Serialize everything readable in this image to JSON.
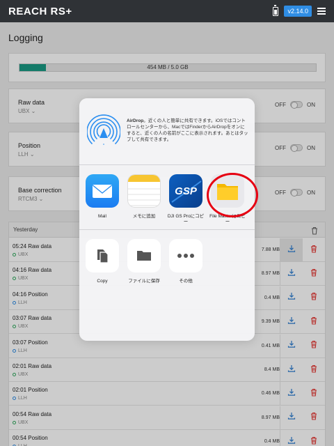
{
  "topbar": {
    "brand": "REACH RS+",
    "version": "v2.14.0"
  },
  "page": {
    "title": "Logging"
  },
  "storage": {
    "text": "454 MB / 5.0 GB",
    "used_fraction": 0.09
  },
  "streams": [
    {
      "label": "Raw data",
      "format": "UBX ⌄",
      "off": "OFF",
      "on": "ON"
    },
    {
      "label": "Position",
      "format": "LLH ⌄",
      "off": "OFF",
      "on": "ON"
    },
    {
      "label": "Base correction",
      "format": "RTCM3 ⌄",
      "off": "OFF",
      "on": "ON"
    }
  ],
  "log": {
    "header": "Yesterday",
    "rows": [
      {
        "time": "05:24 Raw data",
        "fmt": "UBX",
        "size": "7.88 MB",
        "dot": "green"
      },
      {
        "time": "04:16 Raw data",
        "fmt": "UBX",
        "size": "8.97 MB",
        "dot": "green"
      },
      {
        "time": "04:16 Position",
        "fmt": "LLH",
        "size": "0.4 MB",
        "dot": "blue"
      },
      {
        "time": "03:07 Raw data",
        "fmt": "UBX",
        "size": "9.39 MB",
        "dot": "green"
      },
      {
        "time": "03:07 Position",
        "fmt": "LLH",
        "size": "0.41 MB",
        "dot": "blue"
      },
      {
        "time": "02:01 Raw data",
        "fmt": "UBX",
        "size": "8.4 MB",
        "dot": "green"
      },
      {
        "time": "02:01 Position",
        "fmt": "LLH",
        "size": "0.46 MB",
        "dot": "blue"
      },
      {
        "time": "00:54 Raw data",
        "fmt": "UBX",
        "size": "8.97 MB",
        "dot": "green"
      },
      {
        "time": "00:54 Position",
        "fmt": "LLH",
        "size": "0.4 MB",
        "dot": "blue"
      }
    ]
  },
  "share_sheet": {
    "airdrop_title": "AirDrop",
    "airdrop_text": "。近くの人と簡単に共有できます。iOSではコントロールセンターから、MacではFinderからAirDropをオンにすると、近くの人の名前がここに表示されます。あとはタップして共有できます。",
    "apps": [
      {
        "label": "Mail"
      },
      {
        "label": "メモに追加"
      },
      {
        "label": "DJI GS Proにコピー",
        "icon_text": "GSP"
      },
      {
        "label": "File Masterにコピー"
      }
    ],
    "actions": [
      {
        "label": "Copy"
      },
      {
        "label": "ファイルに保存"
      },
      {
        "label": "その他"
      }
    ]
  },
  "colors": {
    "topbar": "#2f3236",
    "accent": "#1a9a84",
    "version_badge": "#2f8de4",
    "delete": "#e53935",
    "highlight": "#e60012"
  }
}
